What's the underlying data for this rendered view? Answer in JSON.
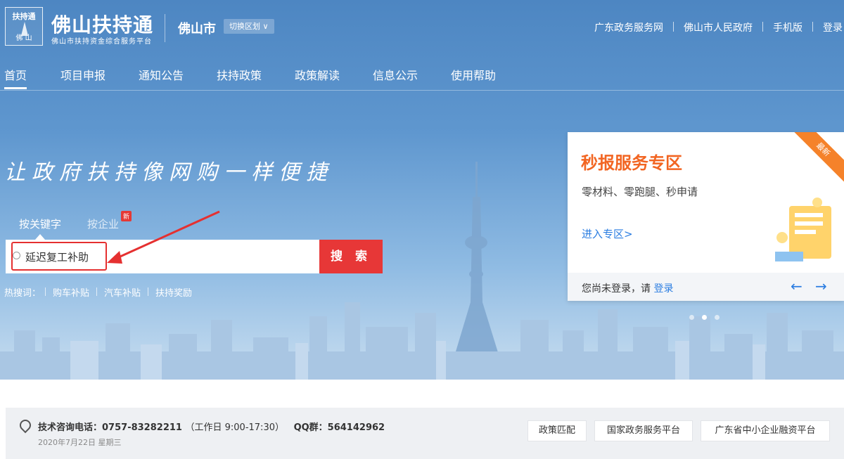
{
  "header": {
    "logo_top": "扶持通",
    "logo_bottom": "佛 山",
    "site_name": "佛山扶持通",
    "site_subtitle": "佛山市扶持资金综合服务平台",
    "city": "佛山市",
    "switch_label": "切换区划 ∨",
    "links": [
      "广东政务服务网",
      "佛山市人民政府",
      "手机版",
      "登录"
    ]
  },
  "nav": {
    "items": [
      "首页",
      "项目申报",
      "通知公告",
      "扶持政策",
      "政策解读",
      "信息公示",
      "使用帮助"
    ]
  },
  "hero": {
    "slogan": "让政府扶持像网购一样便捷"
  },
  "search": {
    "tabs": [
      "按关键字",
      "按企业"
    ],
    "new_badge": "新",
    "value": "延迟复工补助",
    "button_label": "搜 索",
    "hotwords_label": "热搜词：",
    "hotwords": [
      "购车补贴",
      "汽车补贴",
      "扶持奖励"
    ]
  },
  "card": {
    "ribbon": "最新",
    "title": "秒报服务专区",
    "desc": "零材料、零跑腿、秒申请",
    "link": "进入专区>",
    "login_tip": "您尚未登录，请",
    "login_link": "登录",
    "prev": "←",
    "next": "→"
  },
  "carousel": {
    "count": 3,
    "active_index": 1
  },
  "info": {
    "phone_label": "技术咨询电话：",
    "phone": "0757-83282211",
    "hours": "（工作日 9:00-17:30）",
    "qq_label": "QQ群：",
    "qq": "564142962",
    "date": "2020年7月22日  星期三",
    "buttons": [
      "政策匹配",
      "国家政务服务平台",
      "广东省中小企业融资平台"
    ]
  },
  "colors": {
    "accent_red": "#e73737",
    "accent_orange": "#f26522",
    "link_blue": "#2b7de1",
    "hero_blue": "#4d86c2"
  }
}
